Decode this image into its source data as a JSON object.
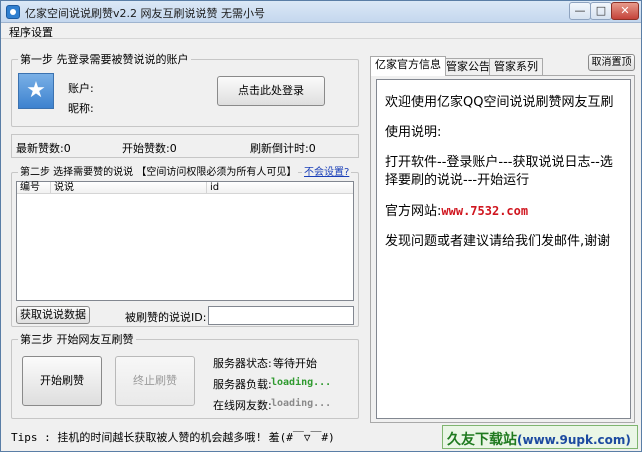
{
  "window": {
    "title": "亿家空间说说刷赞v2.2 网友互刷说说赞 无需小号",
    "min": "—",
    "max": "□",
    "close": "✕"
  },
  "menu": {
    "settings": "程序设置"
  },
  "step1": {
    "title": "第一步 先登录需要被赞说说的账户",
    "account_label": "账户:",
    "nickname_label": "昵称:",
    "login_button": "点击此处登录"
  },
  "stats": {
    "latest_likes": "最新赞数:0",
    "start_likes": "开始赞数:0",
    "countdown": "刷新倒计时:0"
  },
  "step2": {
    "title": "第二步 选择需要赞的说说 【空间访问权限必须为所有人可见】",
    "help_link": "不会设置?",
    "columns": [
      "编号",
      "说说",
      "id"
    ],
    "fetch_button": "获取说说数据",
    "id_label": "被刷赞的说说ID:",
    "id_value": ""
  },
  "step3": {
    "title": "第三步 开始网友互刷赞",
    "start_button": "开始刷赞",
    "stop_button": "终止刷赞",
    "server_status_label": "服务器状态:",
    "server_status_value": "等待开始",
    "server_load_label": "服务器负载:",
    "server_load_value": "loading...",
    "online_label": "在线网友数:",
    "online_value": "loading..."
  },
  "right_panel": {
    "tabs": [
      "亿家官方信息",
      "管家公告",
      "管家系列"
    ],
    "cancel_button": "取消置顶",
    "welcome": "欢迎使用亿家QQ空间说说刷赞网友互刷",
    "usage_title": "使用说明:",
    "usage_text": "打开软件--登录账户---获取说说日志--选择要刷的说说---开始运行",
    "site_label": "官方网站:",
    "site_url": "www.7532.com",
    "feedback": "发现问题或者建议请给我们发邮件,谢谢"
  },
  "footer": {
    "tips": "Tips : 挂机的时间越长获取被人赞的机会越多哦! 羞(#￣▽￣#)",
    "logo_main": "久友下载站",
    "logo_sub": "(www.9upk.com)"
  },
  "colors": {
    "link": "#d0151e",
    "loading_active": "#2f9a2f",
    "loading_idle": "#8a8a8a",
    "logo_green": "#1f7a1f"
  }
}
